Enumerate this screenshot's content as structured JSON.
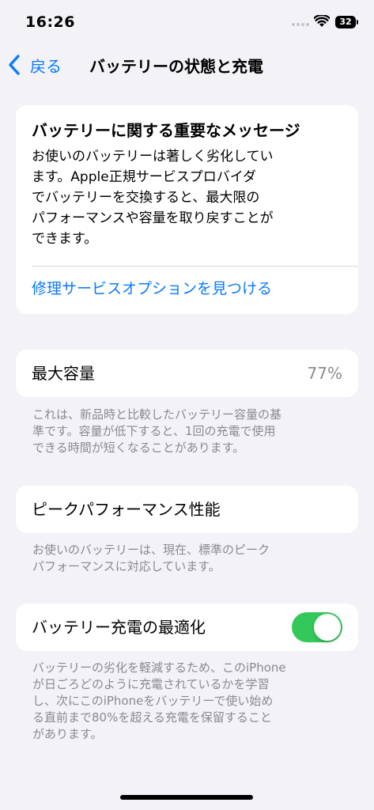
{
  "status_bar": {
    "time": "16:26",
    "battery_level": "32",
    "icons": [
      "signal-icon",
      "wifi-icon",
      "battery-icon"
    ]
  },
  "nav": {
    "back_label": "戻る",
    "title": "バッテリーの状態と充電"
  },
  "message_card": {
    "title": "バッテリーに関する重要なメッセージ",
    "body_lines": [
      "お使いのバッテリーは著しく劣化してい",
      "ます。Apple正規サービスプロバイダ",
      "でバッテリーを交換すると、最大限の",
      "パフォーマンスや容量を取り戻すことが",
      "できます。"
    ],
    "link": "修理サービスオプションを見つける"
  },
  "max_capacity": {
    "label": "最大容量",
    "value": "77%",
    "footnote_lines": [
      "これは、新品時と比較したバッテリー容量の基",
      "準です。容量が低下すると、1回の充電で使用",
      "できる時間が短くなることがあります。"
    ]
  },
  "peak_performance": {
    "label": "ピークパフォーマンス性能",
    "footnote_lines": [
      "お使いのバッテリーは、現在、標準のピーク",
      "パフォーマンスに対応しています。"
    ]
  },
  "optimized_charging": {
    "label": "バッテリー充電の最適化",
    "enabled": true,
    "toggle_color": "#34c759",
    "footnote_lines": [
      "バッテリーの劣化を軽減するため、このiPhone",
      "が日ごろどのように充電されているかを学習",
      "し、次にこのiPhoneをバッテリーで使い始め",
      "る直前まで80%を超える充電を保留すること",
      "があります。"
    ]
  },
  "colors": {
    "accent": "#0a7aff",
    "background": "#f2f2f7",
    "secondary_text": "#8a8a8e"
  }
}
